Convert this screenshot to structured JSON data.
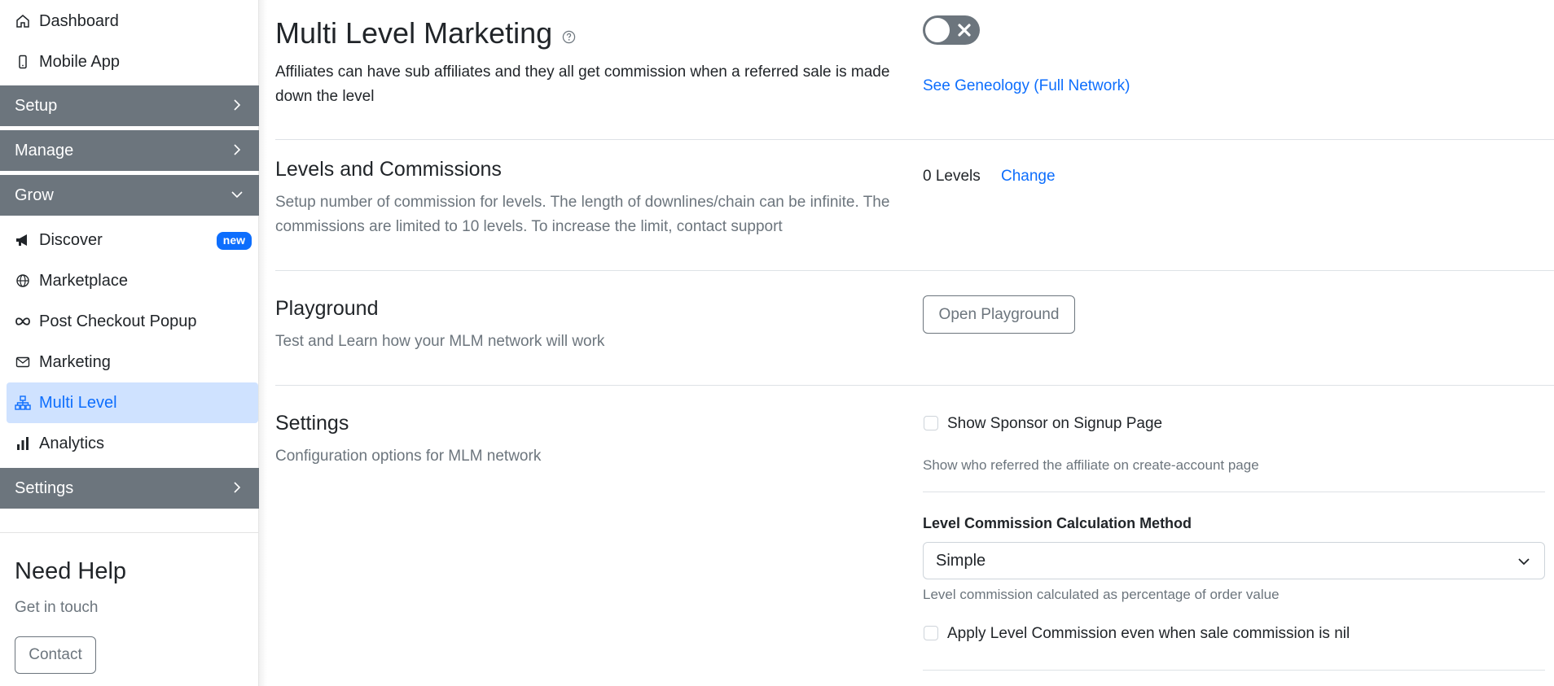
{
  "sidebar": {
    "items_top": [
      {
        "label": "Dashboard",
        "icon": "home-icon"
      },
      {
        "label": "Mobile App",
        "icon": "mobile-icon"
      }
    ],
    "sections": {
      "setup": "Setup",
      "manage": "Manage",
      "grow": "Grow",
      "settings": "Settings"
    },
    "grow_items": [
      {
        "label": "Discover",
        "icon": "megaphone-icon",
        "badge": "new"
      },
      {
        "label": "Marketplace",
        "icon": "globe-icon"
      },
      {
        "label": "Post Checkout Popup",
        "icon": "infinity-icon"
      },
      {
        "label": "Marketing",
        "icon": "envelope-icon"
      },
      {
        "label": "Multi Level",
        "icon": "diagram-icon",
        "active": true
      },
      {
        "label": "Analytics",
        "icon": "bar-chart-icon"
      }
    ],
    "help": {
      "title": "Need Help",
      "subtitle": "Get in touch",
      "contact_button": "Contact"
    }
  },
  "main": {
    "mlm": {
      "title": "Multi Level Marketing",
      "description": "Affiliates can have sub affiliates and they all get commission when a referred sale is made down the level",
      "enabled": false,
      "genealogy_link": "See Geneology (Full Network)"
    },
    "levels": {
      "title": "Levels and Commissions",
      "description": "Setup number of commission for levels. The length of downlines/chain can be infinite. The commissions are limited to 10 levels. To increase the limit, contact support",
      "count_text": "0 Levels",
      "change_link": "Change"
    },
    "playground": {
      "title": "Playground",
      "description": "Test and Learn how your MLM network will work",
      "button": "Open Playground"
    },
    "settings": {
      "title": "Settings",
      "description": "Configuration options for MLM network",
      "show_sponsor_label": "Show Sponsor on Signup Page",
      "show_sponsor_checked": false,
      "show_sponsor_help": "Show who referred the affiliate on create-account page",
      "calc_method_label": "Level Commission Calculation Method",
      "calc_method_value": "Simple",
      "calc_method_help": "Level commission calculated as percentage of order value",
      "apply_nil_label": "Apply Level Commission even when sale commission is nil",
      "apply_nil_checked": false
    }
  },
  "colors": {
    "primary": "#0d6efd",
    "section_header_bg": "#6c757d",
    "active_item_bg": "#cfe2ff"
  }
}
